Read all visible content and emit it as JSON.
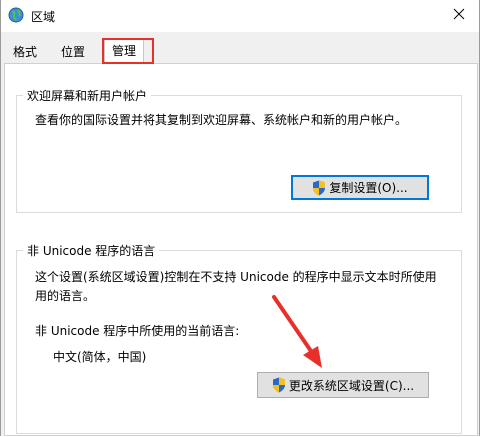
{
  "window": {
    "title": "区域",
    "icon": "globe-icon",
    "close_icon": "close-icon"
  },
  "tabs": [
    {
      "label": "格式",
      "active": false
    },
    {
      "label": "位置",
      "active": false
    },
    {
      "label": "管理",
      "active": true
    }
  ],
  "welcome_group": {
    "title": "欢迎屏幕和新用户帐户",
    "description": "查看你的国际设置并将其复制到欢迎屏幕、系统帐户和新的用户帐户。",
    "copy_button_label": "复制设置(O)..."
  },
  "unicode_group": {
    "title": "非 Unicode 程序的语言",
    "description_line1": "这个设置(系统区域设置)控制在不支持 Unicode 的程序中显示文本时所使用",
    "description_line2": "用的语言。",
    "current_language_label": "非 Unicode 程序中所使用的当前语言:",
    "current_language_value": "中文(简体，中国)",
    "change_button_label": "更改系统区域设置(C)..."
  },
  "annotations": {
    "highlight_color": "#e8302a",
    "arrow_color": "#e8302a"
  }
}
